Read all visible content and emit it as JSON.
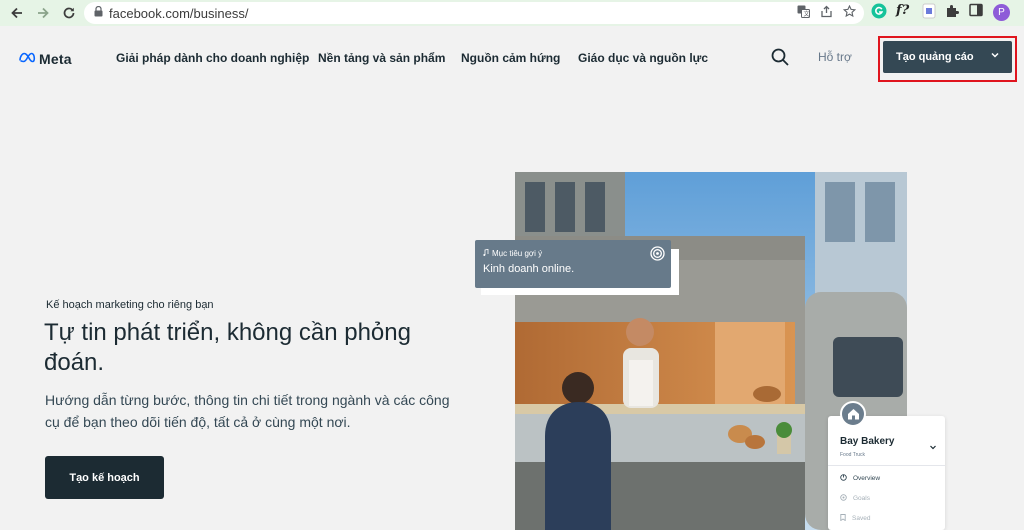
{
  "browser": {
    "url": "facebook.com/business/",
    "profile_initial": "P",
    "ext_script_label": "f?"
  },
  "header": {
    "logo_text": "Meta",
    "nav_items": [
      "Giải pháp dành cho doanh nghiệp",
      "Nền tảng và sản phẩm",
      "Nguồn cảm hứng",
      "Giáo dục và nguồn lực"
    ],
    "support_label": "Hỗ trợ",
    "cta_label": "Tạo quảng cáo",
    "highlight_color": "#e0141e"
  },
  "hero": {
    "eyebrow": "Kế hoạch marketing cho riêng bạn",
    "headline": "Tự tin phát triển, không cần phỏng đoán.",
    "lede": "Hướng dẫn từng bước, thông tin chi tiết trong ngành và các công cụ để bạn theo dõi tiến độ, tất cả ở cùng một nơi.",
    "plan_button": "Tạo kế hoạch"
  },
  "goal_card": {
    "label": "Mục tiêu gợi ý",
    "value": "Kinh doanh online."
  },
  "business_card": {
    "name": "Bay Bakery",
    "subtitle": "Food Truck",
    "items": [
      "Overview",
      "Goals",
      "Saved"
    ]
  },
  "colors": {
    "cta_bg": "#344854",
    "dark": "#1c2b33",
    "page_bg": "#f2f2f2",
    "chrome_bg": "#e6f4e6"
  }
}
